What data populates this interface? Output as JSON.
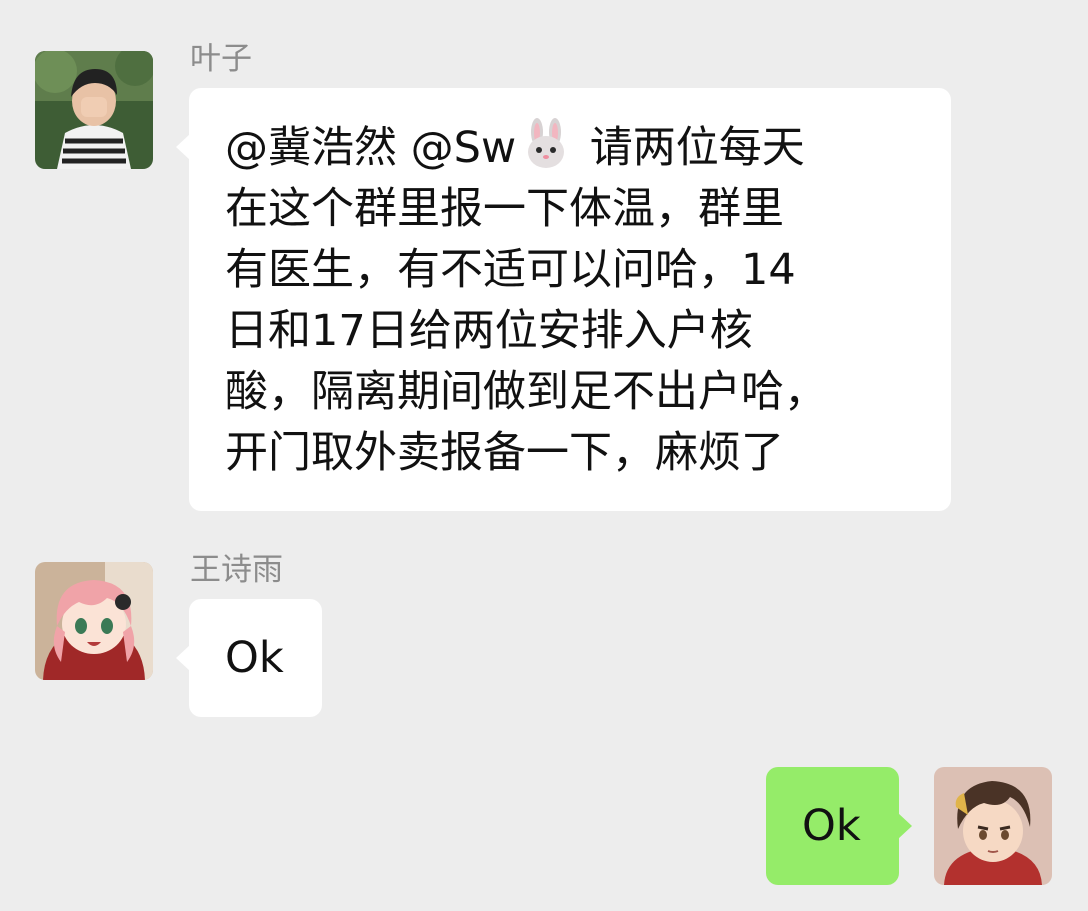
{
  "chat": {
    "messages": [
      {
        "sender": "叶子",
        "text_before": "@冀浩然 @Sw",
        "emoji": "rabbit-face",
        "text_after": " 请两位每天\n在这个群里报一下体温，群里\n有医生，有不适可以问哈，14\n日和17日给两位安排入户核\n酸，隔离期间做到足不出户哈，\n开门取外卖报备一下，麻烦了"
      },
      {
        "sender": "王诗雨",
        "text": "Ok"
      },
      {
        "sender": "",
        "text": "Ok"
      }
    ]
  },
  "colors": {
    "background": "#ededed",
    "incoming_bubble": "#ffffff",
    "outgoing_bubble": "#95ec69",
    "sender_name": "#8c8c8c",
    "text": "#111111"
  }
}
